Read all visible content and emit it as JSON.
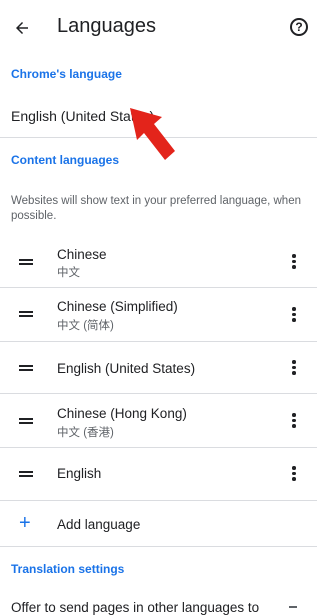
{
  "header": {
    "title": "Languages"
  },
  "icons": {
    "back": "arrow-back-icon",
    "help": "help-circle-icon",
    "drag": "drag-handle-icon",
    "more": "more-vert-icon",
    "add": "plus-icon"
  },
  "sections": {
    "chrome_language": "Chrome's language",
    "content_languages": "Content languages",
    "translation_settings": "Translation settings"
  },
  "chrome_language_value": "English (United States)",
  "content_description": "Websites will show text in your preferred language, when possible.",
  "languages": [
    {
      "name": "Chinese",
      "native": "中文"
    },
    {
      "name": "Chinese (Simplified)",
      "native": "中文 (简体)"
    },
    {
      "name": "English (United States)",
      "native": ""
    },
    {
      "name": "Chinese (Hong Kong)",
      "native": "中文 (香港)"
    },
    {
      "name": "English",
      "native": ""
    }
  ],
  "add_language_label": "Add language",
  "translation_offer_text": "Offer to send pages in other languages to",
  "colors": {
    "accent": "#1a73e8",
    "annotation_arrow": "#e3241b",
    "divider": "#dadce0"
  }
}
